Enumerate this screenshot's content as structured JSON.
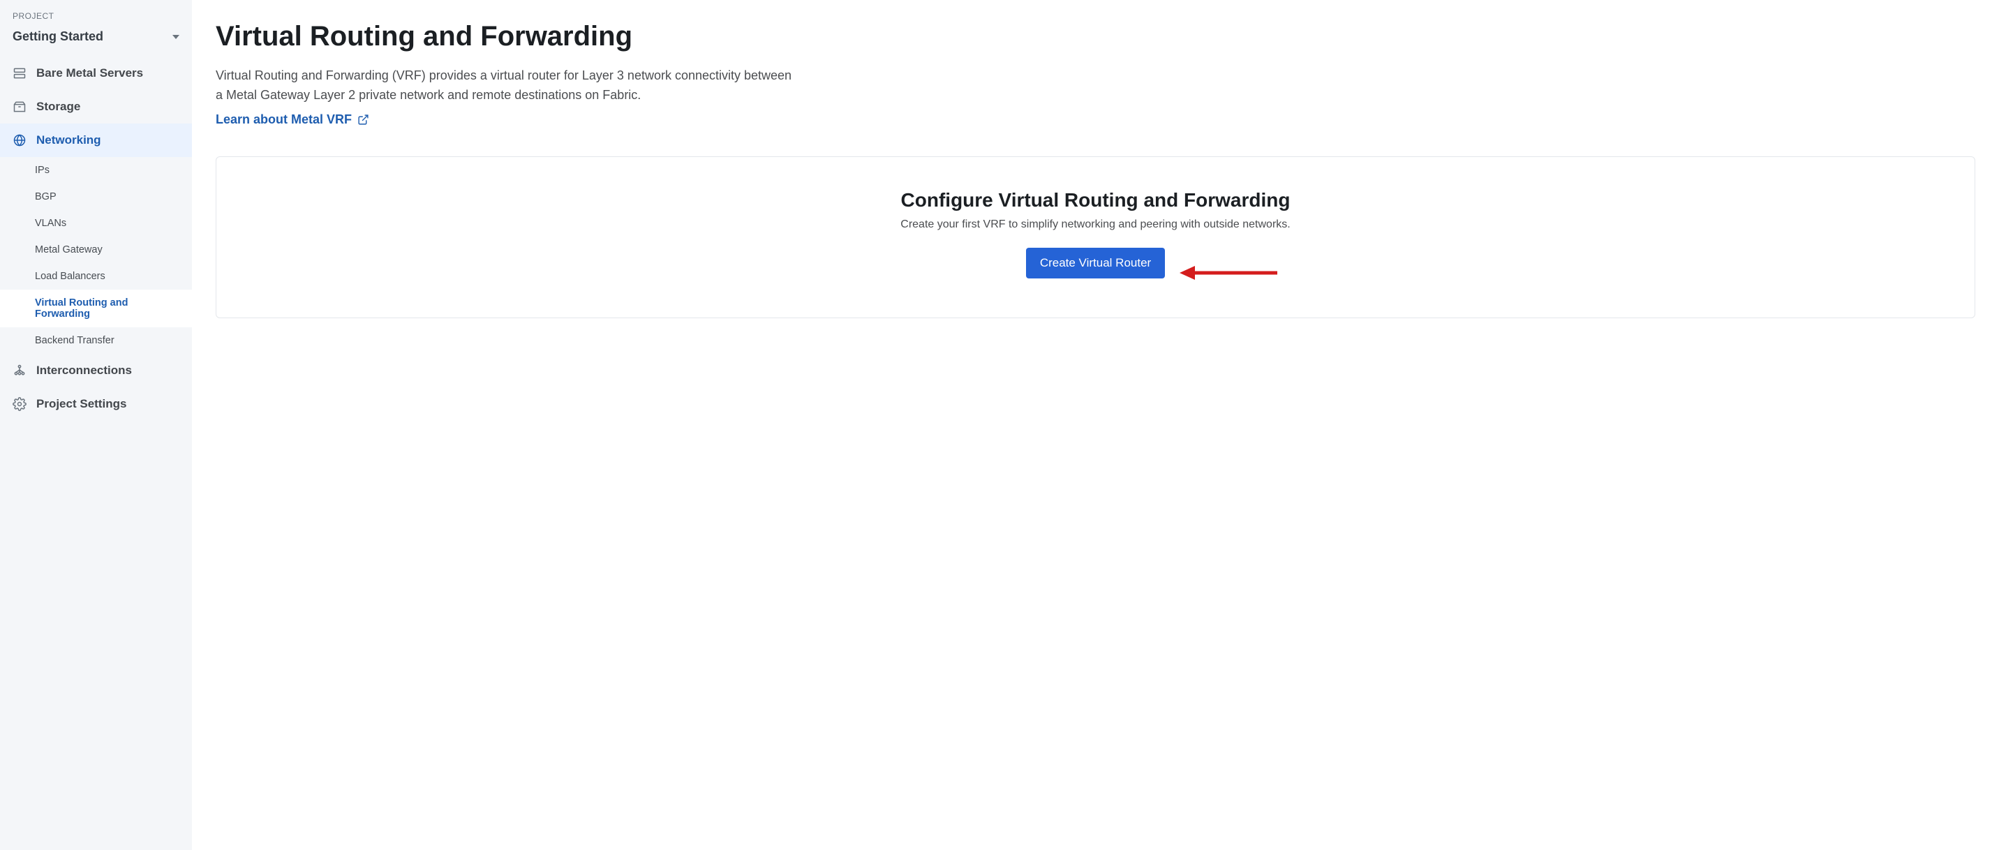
{
  "sidebar": {
    "section_label": "PROJECT",
    "project_name": "Getting Started",
    "items": {
      "servers": {
        "label": "Bare Metal Servers"
      },
      "storage": {
        "label": "Storage"
      },
      "networking": {
        "label": "Networking"
      },
      "interconn": {
        "label": "Interconnections"
      },
      "settings": {
        "label": "Project Settings"
      }
    },
    "networking_sub": [
      "IPs",
      "BGP",
      "VLANs",
      "Metal Gateway",
      "Load Balancers",
      "Virtual Routing and Forwarding",
      "Backend Transfer"
    ]
  },
  "main": {
    "title": "Virtual Routing and Forwarding",
    "description": "Virtual Routing and Forwarding (VRF) provides a virtual router for Layer 3 network connectivity between a Metal Gateway Layer 2 private network and remote destinations on Fabric.",
    "doc_link_label": "Learn about Metal VRF",
    "panel": {
      "title": "Configure Virtual Routing and Forwarding",
      "subtitle": "Create your first VRF to simplify networking and peering with outside networks.",
      "cta": "Create Virtual Router"
    }
  }
}
